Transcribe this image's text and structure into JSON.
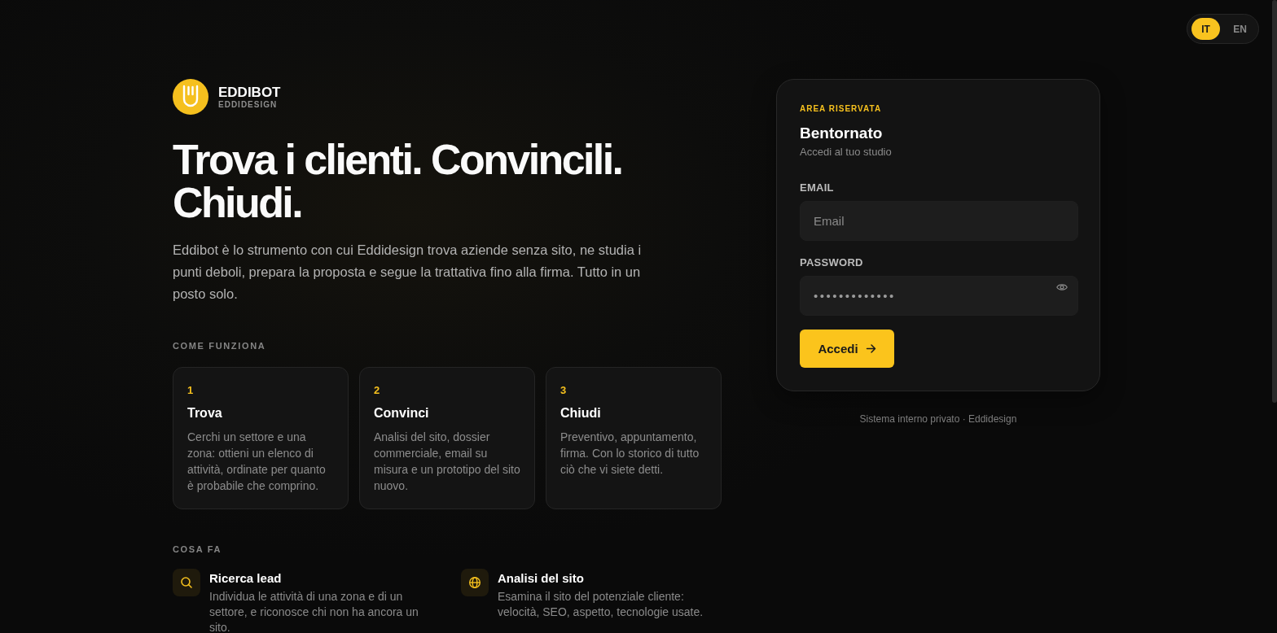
{
  "language_switch": [
    {
      "label": "IT",
      "selected": true
    },
    {
      "label": "EN",
      "selected": false
    }
  ],
  "brand": {
    "name": "EDDIBOT",
    "subtitle": "EDDIDESIGN"
  },
  "hero": {
    "headline": "Trova i clienti. Convincili. Chiudi.",
    "description": "Eddibot è lo strumento con cui Eddidesign trova aziende senza sito, ne studia i punti deboli, prepara la proposta e segue la trattativa fino alla firma. Tutto in un posto solo."
  },
  "how_it_works": {
    "heading": "COME FUNZIONA",
    "steps": [
      {
        "number": "1",
        "title": "Trova",
        "description": "Cerchi un settore e una zona: ottieni un elenco di attività, ordinate per quanto è probabile che comprino."
      },
      {
        "number": "2",
        "title": "Convinci",
        "description": "Analisi del sito, dossier commerciale, email su misura e un prototipo del sito nuovo."
      },
      {
        "number": "3",
        "title": "Chiudi",
        "description": "Preventivo, appuntamento, firma. Con lo storico di tutto ciò che vi siete detti."
      }
    ]
  },
  "features": {
    "heading": "COSA FA",
    "items": [
      {
        "kind": "search",
        "title": "Ricerca lead",
        "description": "Individua le attività di una zona e di un settore, e riconosce chi non ha ancora un sito."
      },
      {
        "kind": "globe",
        "title": "Analisi del sito",
        "description": "Esamina il sito del potenziale cliente: velocità, SEO, aspetto, tecnologie usate."
      }
    ]
  },
  "login": {
    "eyebrow": "AREA RISERVATA",
    "title": "Bentornato",
    "subtitle": "Accedi al tuo studio",
    "fields": [
      {
        "kind": "email",
        "label": "EMAIL",
        "placeholder": "Email"
      },
      {
        "kind": "password",
        "label": "PASSWORD",
        "value": "•••••••••••••"
      }
    ],
    "submit": {
      "label": "Accedi"
    }
  },
  "footer_note": "Sistema interno privato · Eddidesign"
}
